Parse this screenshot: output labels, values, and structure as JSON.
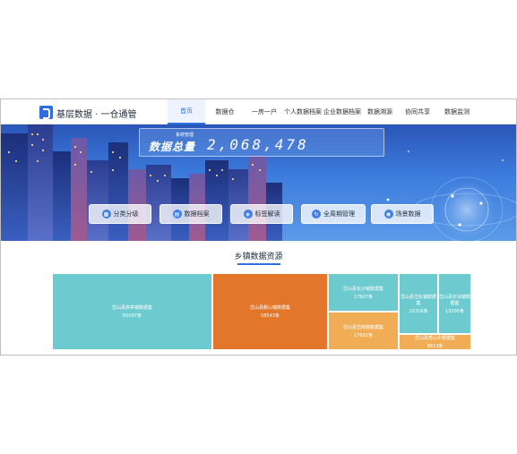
{
  "header": {
    "brand": "基层数据 · 一仓通管",
    "nav": [
      {
        "label": "首页",
        "active": true
      },
      {
        "label": "数据仓",
        "active": false
      },
      {
        "label": "一房一户",
        "active": false
      },
      {
        "label": "个人数据档案",
        "active": false
      },
      {
        "label": "企业数据档案",
        "active": false
      },
      {
        "label": "数据溯源",
        "active": false
      },
      {
        "label": "协同共享",
        "active": false
      },
      {
        "label": "数据监测",
        "active": false
      }
    ]
  },
  "banner": {
    "stat_subtitle": "系统管理",
    "stat_label": "数据总量",
    "stat_value": "2,068,478",
    "buttons": [
      {
        "label": "分类分级",
        "icon": "grid-icon"
      },
      {
        "label": "数据档案",
        "icon": "archive-icon"
      },
      {
        "label": "标签解读",
        "icon": "tag-icon"
      },
      {
        "label": "全周期管理",
        "icon": "cycle-icon"
      },
      {
        "label": "场景数据",
        "icon": "scene-icon"
      }
    ]
  },
  "section": {
    "title": "乡镇数据资源",
    "tiles": [
      {
        "name": "岱山县高亭镇数据集",
        "count": "81097条",
        "color": "#6dcbd0"
      },
      {
        "name": "岱山县衢山镇数据集",
        "count": "58543条",
        "color": "#e2762a"
      },
      {
        "name": "岱山县东沙镇数据集",
        "count": "17927条",
        "color": "#6dcbd0"
      },
      {
        "name": "岱山县岱东镇数据集",
        "count": "15316条",
        "color": "#6dcbd0"
      },
      {
        "name": "岱山县长涂镇数据集",
        "count": "13295条",
        "color": "#6dcbd0"
      },
      {
        "name": "岱山县岱西镇数据集",
        "count": "17882条",
        "color": "#f0ad55"
      },
      {
        "name": "岱山县秀山乡数据集",
        "count": "8613条",
        "color": "#f0ad55"
      }
    ]
  }
}
